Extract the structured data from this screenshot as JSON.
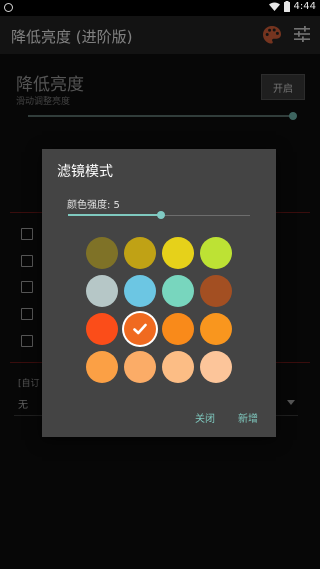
{
  "status_bar": {
    "time": "4:44"
  },
  "app_bar": {
    "title": "降低亮度 (进阶版)"
  },
  "brightness": {
    "title": "降低亮度",
    "subtitle": "滑动调整亮度",
    "toggle_label": "开启",
    "level": 1.0
  },
  "custom_row": {
    "label": "[自订",
    "value": "无"
  },
  "dialog": {
    "title": "滤镜模式",
    "intensity_label": "颜色强度: 5",
    "intensity_fraction": 0.51,
    "swatches": [
      "#7f7227",
      "#c0a215",
      "#e6d11a",
      "#bde234",
      "#b6c7c7",
      "#6cc6e3",
      "#78d6be",
      "#a34f22",
      "#fb4d19",
      "#f06a20",
      "#f98a1a",
      "#f9961e",
      "#fba045",
      "#fbac67",
      "#fcbd85",
      "#fcc59a"
    ],
    "selected_index": 9,
    "close_label": "关闭",
    "add_label": "新增"
  },
  "colors": {
    "accent": "#80cbc4",
    "dialog_bg": "#444444",
    "app_bar_bg": "#242424"
  }
}
